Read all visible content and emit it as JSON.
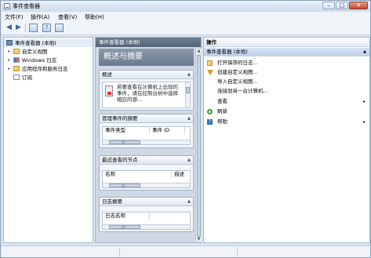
{
  "window": {
    "title": "事件查看器"
  },
  "menu": [
    "文件(F)",
    "操作(A)",
    "查看(V)",
    "帮助(H)"
  ],
  "tree": {
    "root": "事件查看器 (本地)",
    "items": [
      "自定义视图",
      "Windows 日志",
      "应用程序和服务日志",
      "订阅"
    ]
  },
  "middle": {
    "header": "事件查看器 (本地)",
    "banner": "概述与摘要",
    "overview": {
      "title": "概述",
      "text": "若要查看在计算机上出现的事件，请在控制台树中选择相应的源..."
    },
    "summary": {
      "title": "管理事件的摘要",
      "columns": [
        "事件类型",
        "事件 ID"
      ]
    },
    "recent": {
      "title": "最近查看的节点",
      "columns": [
        "名称",
        "描述"
      ]
    },
    "logs": {
      "title": "日志摘要",
      "columns": [
        "日志名称"
      ]
    }
  },
  "actions": {
    "header": "操作",
    "section": "事件查看器 (本地)",
    "items": [
      {
        "label": "打开保存的日志...",
        "icon": "open-log-icon",
        "arrow": false
      },
      {
        "label": "创建自定义视图...",
        "icon": "filter-icon",
        "arrow": false
      },
      {
        "label": "导入自定义视图...",
        "icon": "",
        "arrow": false
      },
      {
        "label": "连接到另一台计算机...",
        "icon": "",
        "arrow": false
      },
      {
        "label": "查看",
        "icon": "",
        "arrow": true
      },
      {
        "label": "刷新",
        "icon": "refresh-icon",
        "arrow": false
      },
      {
        "label": "帮助",
        "icon": "help-icon",
        "arrow": true
      }
    ]
  },
  "icons": {
    "help_glyph": "?",
    "arrow": "▸",
    "collapse": "▲",
    "back": "◀",
    "forward": "▶"
  }
}
